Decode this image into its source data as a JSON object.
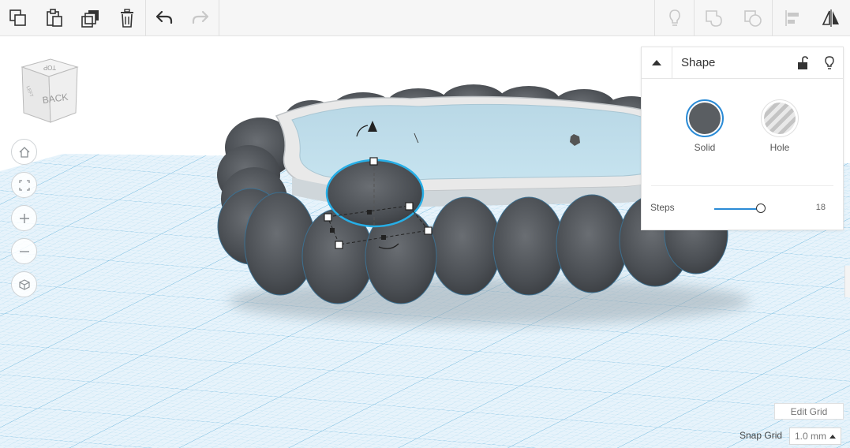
{
  "toolbar": {
    "left": [
      {
        "name": "copy-button",
        "icon": "copy-icon"
      },
      {
        "name": "paste-button",
        "icon": "paste-icon"
      },
      {
        "name": "duplicate-button",
        "icon": "duplicate-icon"
      },
      {
        "name": "delete-button",
        "icon": "trash-icon"
      },
      {
        "name": "undo-button",
        "icon": "undo-icon"
      },
      {
        "name": "redo-button",
        "icon": "redo-icon"
      }
    ],
    "right": [
      {
        "name": "notes-button",
        "icon": "lightbulb-icon"
      },
      {
        "name": "group-button",
        "icon": "group-icon"
      },
      {
        "name": "ungroup-button",
        "icon": "ungroup-icon"
      },
      {
        "name": "align-button",
        "icon": "align-icon"
      },
      {
        "name": "mirror-button",
        "icon": "mirror-icon"
      }
    ]
  },
  "viewcube": {
    "top": "TOP",
    "back": "BACK",
    "left": "LEFT"
  },
  "nav": [
    "home-icon",
    "fit-icon",
    "zoom-in-icon",
    "zoom-out-icon",
    "perspective-icon"
  ],
  "panel": {
    "title": "Shape",
    "solid_label": "Solid",
    "hole_label": "Hole",
    "steps_label": "Steps",
    "steps_value": "18",
    "steps_fraction": 0.9,
    "colors": {
      "solid": "#5a5e62",
      "accent": "#2b8bd6"
    }
  },
  "grid": {
    "edit_label": "Edit Grid",
    "snap_label": "Snap Grid",
    "snap_value": "1.0 mm"
  },
  "colors": {
    "grid_bg": "#e7f3fb",
    "grid_line": "#9fd0ea",
    "shape": "#4a4e53",
    "select": "#27aee6"
  }
}
